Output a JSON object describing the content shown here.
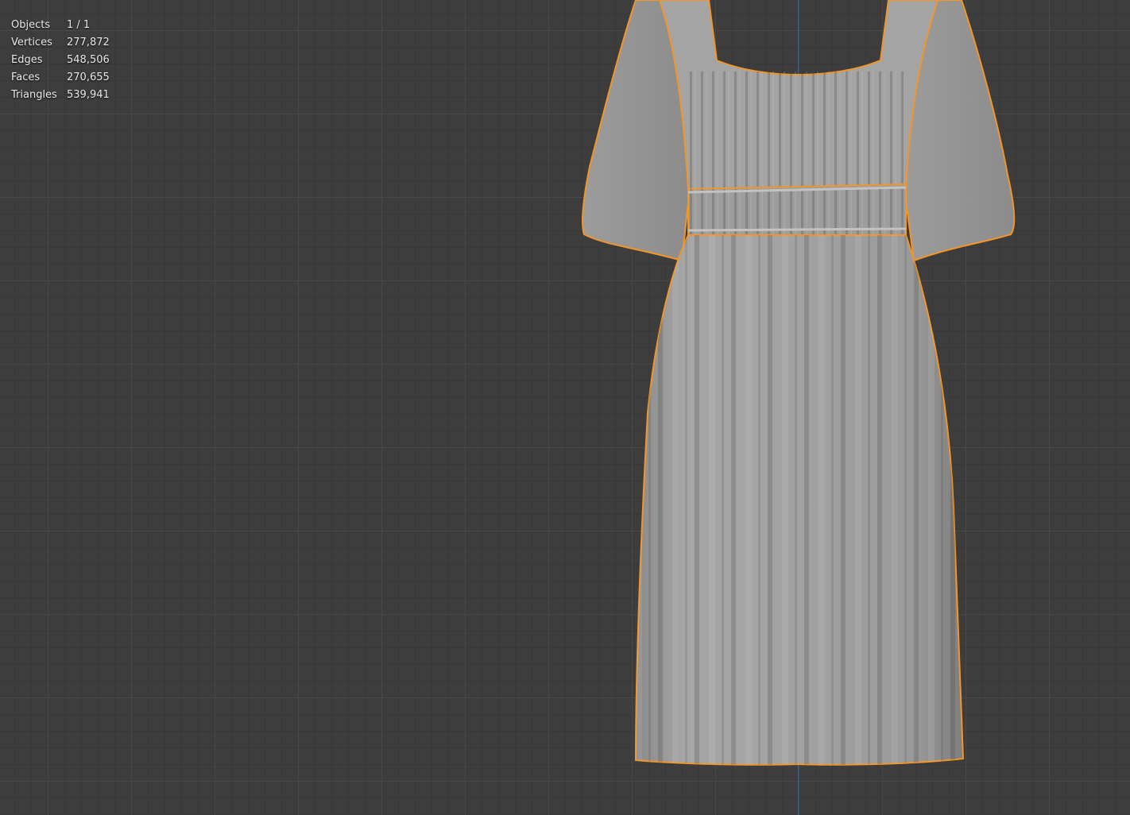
{
  "stats": [
    {
      "label": "Objects",
      "value": "1 / 1"
    },
    {
      "label": "Vertices",
      "value": "277,872"
    },
    {
      "label": "Edges",
      "value": "548,506"
    },
    {
      "label": "Faces",
      "value": "270,655"
    },
    {
      "label": "Triangles",
      "value": "539,941"
    }
  ],
  "colors": {
    "viewport_bg": "#3d3d3d",
    "selection_outline": "#f0962a",
    "mesh_fill": "#9e9e9e",
    "axis_z": "#3e5f8f"
  }
}
